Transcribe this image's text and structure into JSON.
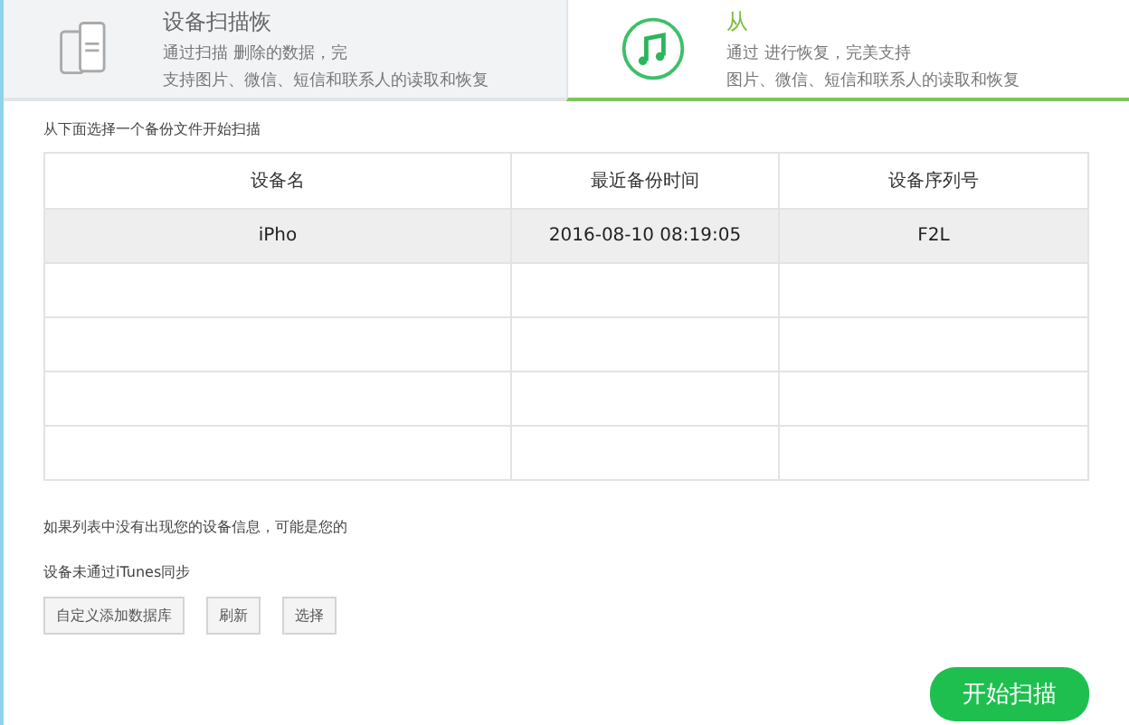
{
  "tabs": [
    {
      "kind": "phone",
      "title": "设备扫描恢",
      "lines": [
        "通过扫描 删除的数据，完",
        "支持图片、微信、短信和联系人的读取和恢复"
      ],
      "selected": false
    },
    {
      "kind": "music",
      "title": "从",
      "lines": [
        "通过 进行恢复，完美支持",
        "图片、微信、短信和联系人的读取和恢复"
      ],
      "selected": true
    }
  ],
  "instruction": "从下面选择一个备份文件开始扫描",
  "table": {
    "columns": [
      "设备名",
      "最近备份时间",
      "设备序列号"
    ],
    "rows": [
      {
        "cells": [
          "iPho",
          "2016-08-10  08:19:05",
          "F2L"
        ],
        "selected": true
      },
      {
        "cells": [],
        "selected": false
      },
      {
        "cells": [],
        "selected": false
      },
      {
        "cells": [],
        "selected": false
      },
      {
        "cells": [],
        "selected": false
      }
    ]
  },
  "notes": [
    "如果列表中没有出现您的设备信息，可能是您的",
    "设备未通过iTunes同步"
  ],
  "buttons": [
    "自定义添加数据库",
    "刷新",
    "选择"
  ],
  "start_button": "开始扫描"
}
